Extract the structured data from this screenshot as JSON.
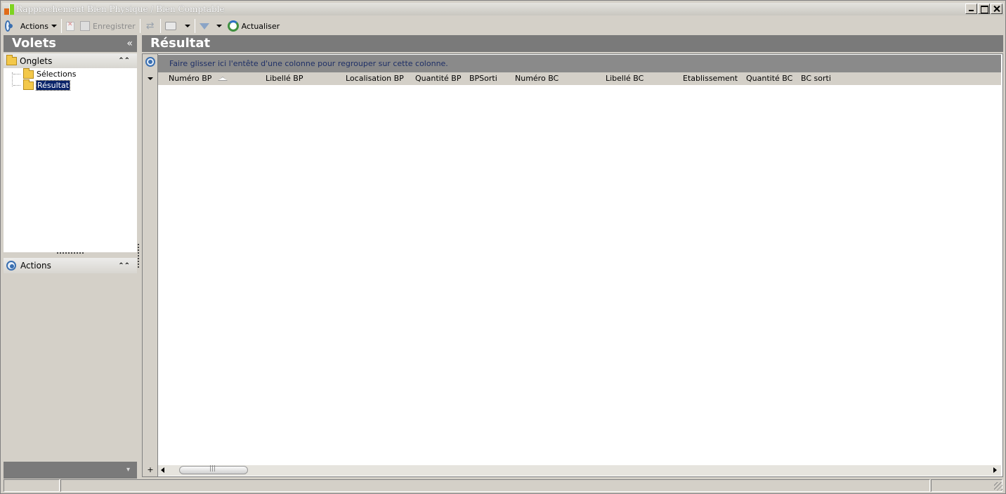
{
  "window": {
    "title": "Rapprochement Bien Physique / Bien Comptable"
  },
  "toolbar": {
    "actions_label": "Actions",
    "save_label": "Enregistrer",
    "refresh_label": "Actualiser"
  },
  "left_pane": {
    "header": "Volets",
    "collapse_glyph": "«",
    "onglets": {
      "label": "Onglets",
      "items": [
        {
          "label": "Sélections",
          "selected": false
        },
        {
          "label": "Résultat",
          "selected": true
        }
      ]
    },
    "actions_label": "Actions"
  },
  "main": {
    "header": "Résultat",
    "group_hint": "Faire glisser ici l'entête d'une colonne pour regrouper sur cette colonne.",
    "columns": [
      "Numéro BP",
      "Libellé BP",
      "Localisation BP",
      "Quantité BP",
      "BPSorti",
      "Numéro BC",
      "Libellé BC",
      "Etablissement",
      "Quantité BC",
      "BC sorti"
    ],
    "sorted_column": "Numéro BP",
    "rows": []
  },
  "icons": {
    "app": "app-icon",
    "actions": "ring-icon",
    "delete": "delete-icon",
    "save": "save-icon",
    "sync": "sync-icon",
    "print": "printer-icon",
    "filter": "filter-icon",
    "refresh": "refresh-icon"
  },
  "colors": {
    "pane_header": "#7a7a7a",
    "selection": "#0a246a",
    "group_hint_text": "#1e2f66"
  }
}
